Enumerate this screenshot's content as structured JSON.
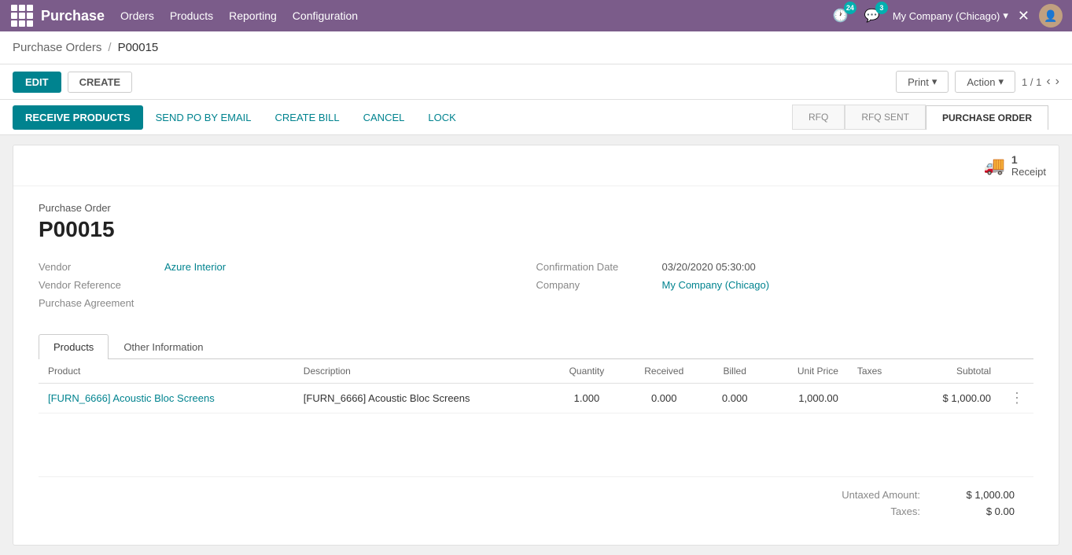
{
  "app": {
    "name": "Purchase"
  },
  "navbar": {
    "menu_items": [
      "Orders",
      "Products",
      "Reporting",
      "Configuration"
    ],
    "notification_count": "24",
    "message_count": "3",
    "company": "My Company (Chicago)",
    "company_dropdown": "▾"
  },
  "breadcrumb": {
    "parent": "Purchase Orders",
    "separator": "/",
    "current": "P00015"
  },
  "toolbar": {
    "edit_label": "EDIT",
    "create_label": "CREATE",
    "print_label": "Print",
    "action_label": "Action",
    "page_info": "1 / 1"
  },
  "status_bar": {
    "receive_label": "RECEIVE PRODUCTS",
    "send_label": "SEND PO BY EMAIL",
    "bill_label": "CREATE BILL",
    "cancel_label": "CANCEL",
    "lock_label": "LOCK",
    "steps": [
      {
        "label": "RFQ",
        "active": false
      },
      {
        "label": "RFQ SENT",
        "active": false
      },
      {
        "label": "PURCHASE ORDER",
        "active": true
      }
    ]
  },
  "receipt_badge": {
    "count": "1",
    "label": "Receipt"
  },
  "po": {
    "label": "Purchase Order",
    "number": "P00015",
    "vendor_label": "Vendor",
    "vendor_value": "Azure Interior",
    "vendor_ref_label": "Vendor Reference",
    "vendor_ref_value": "",
    "purchase_agreement_label": "Purchase Agreement",
    "purchase_agreement_value": "",
    "confirmation_date_label": "Confirmation Date",
    "confirmation_date_value": "03/20/2020 05:30:00",
    "company_label": "Company",
    "company_value": "My Company (Chicago)"
  },
  "tabs": [
    {
      "label": "Products",
      "active": true
    },
    {
      "label": "Other Information",
      "active": false
    }
  ],
  "products_table": {
    "columns": [
      {
        "key": "product",
        "label": "Product"
      },
      {
        "key": "description",
        "label": "Description"
      },
      {
        "key": "quantity",
        "label": "Quantity"
      },
      {
        "key": "received",
        "label": "Received"
      },
      {
        "key": "billed",
        "label": "Billed"
      },
      {
        "key": "unit_price",
        "label": "Unit Price"
      },
      {
        "key": "taxes",
        "label": "Taxes"
      },
      {
        "key": "subtotal",
        "label": "Subtotal"
      }
    ],
    "rows": [
      {
        "product": "[FURN_6666] Acoustic Bloc Screens",
        "description": "[FURN_6666] Acoustic Bloc Screens",
        "quantity": "1.000",
        "received": "0.000",
        "billed": "0.000",
        "unit_price": "1,000.00",
        "taxes": "",
        "subtotal": "$ 1,000.00"
      }
    ]
  },
  "totals": {
    "untaxed_label": "Untaxed Amount:",
    "untaxed_value": "$ 1,000.00",
    "taxes_label": "Taxes:",
    "taxes_value": "$ 0.00"
  }
}
